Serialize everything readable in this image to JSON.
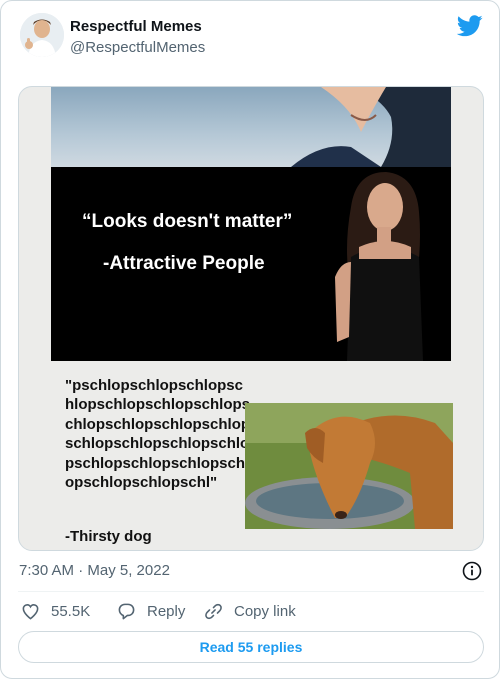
{
  "tweet": {
    "display_name": "Respectful Memes",
    "handle": "@RespectfulMemes",
    "timestamp": "7:30 AM · May 5, 2022"
  },
  "meme": {
    "quote": "“Looks doesn't matter”",
    "quote_attribution": "-Attractive People",
    "dog_text": "\"pschlopschlopschlopschlopschlopschlopschlopschlopschlopschlopschlopschlopschlopschlopschlopschlopschlopschlopschlopschlopschlopschl\"",
    "dog_attribution": "-Thirsty dog"
  },
  "actions": {
    "likes": "55.5K",
    "reply_label": "Reply",
    "copy_label": "Copy link",
    "read_replies_label": "Read 55 replies"
  },
  "icons": {
    "brand": "twitter-bird-icon",
    "like": "heart-icon",
    "reply": "speech-bubble-icon",
    "copy": "link-icon",
    "info": "info-icon"
  },
  "colors": {
    "brand_blue": "#1d9bf0",
    "secondary_text": "#536471",
    "border": "#cfd9de"
  }
}
